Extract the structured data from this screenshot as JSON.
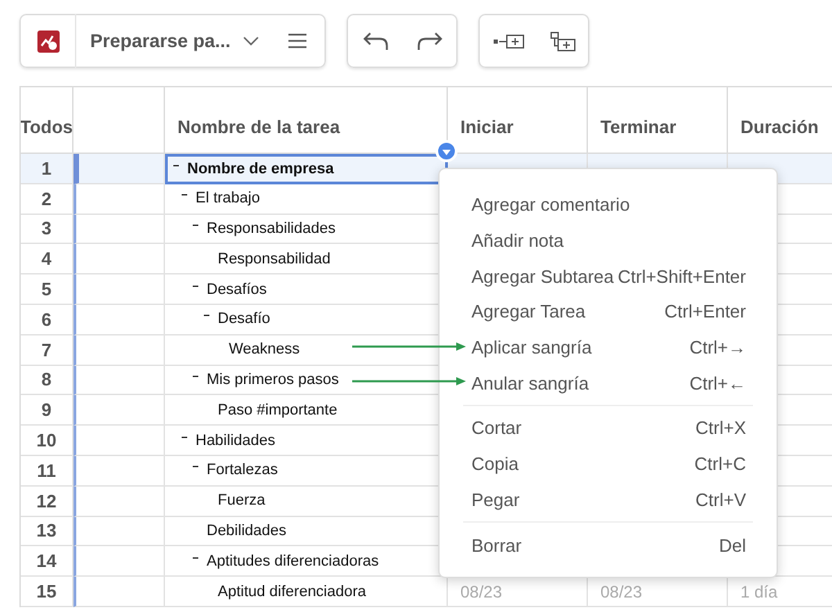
{
  "toolbar": {
    "title": "Prepararse pa..."
  },
  "table": {
    "columns": [
      "Todos",
      "Nombre de la tarea",
      "Iniciar",
      "Terminar",
      "Duración"
    ],
    "rows": [
      {
        "num": "1",
        "name": "Nombre de empresa",
        "selected": true,
        "expanded": true,
        "children": [
          {
            "num": "2",
            "name": "El trabajo",
            "selected": false,
            "expanded": true,
            "children": [
              {
                "num": "3",
                "name": "Responsabilidades",
                "selected": false,
                "expanded": true,
                "children": [
                  {
                    "num": "4",
                    "name": "Responsabilidad",
                    "selected": false
                  }
                ]
              },
              {
                "num": "5",
                "name": "Desafíos",
                "selected": false,
                "expanded": true,
                "children": [
                  {
                    "num": "6",
                    "name": "Desafío",
                    "selected": false,
                    "expanded": true,
                    "children": [
                      {
                        "num": "7",
                        "name": "Weakness",
                        "selected": false
                      }
                    ]
                  }
                ]
              },
              {
                "num": "8",
                "name": "Mis primeros pasos",
                "selected": false,
                "expanded": true,
                "children": [
                  {
                    "num": "9",
                    "name": "Paso #importante",
                    "selected": false
                  }
                ]
              }
            ]
          },
          {
            "num": "10",
            "name": "Habilidades",
            "selected": false,
            "expanded": true,
            "children": [
              {
                "num": "11",
                "name": "Fortalezas",
                "selected": false,
                "expanded": true,
                "children": [
                  {
                    "num": "12",
                    "name": "Fuerza",
                    "selected": false
                  }
                ]
              },
              {
                "num": "13",
                "name": "Debilidades",
                "selected": false
              },
              {
                "num": "14",
                "name": "Aptitudes diferenciadoras",
                "selected": false,
                "expanded": true,
                "children": [
                  {
                    "num": "15",
                    "name": "Aptitud diferenciadora",
                    "selected": false,
                    "start": "08/23",
                    "end": "08/23",
                    "duration": "1 día"
                  }
                ]
              }
            ]
          }
        ]
      }
    ]
  },
  "context_menu": {
    "items": [
      {
        "kind": "item",
        "label": "Agregar comentario",
        "arrow": false
      },
      {
        "kind": "item",
        "label": "Añadir nota",
        "arrow": false
      },
      {
        "kind": "item",
        "label": "Agregar Subtarea",
        "shortcut": "Ctrl+Shift+Enter",
        "arrow": false
      },
      {
        "kind": "item",
        "label": "Agregar Tarea",
        "shortcut": "Ctrl+Enter",
        "arrow": false
      },
      {
        "kind": "item",
        "label": "Aplicar sangría",
        "shortcut": "Ctrl+→",
        "arrow": true
      },
      {
        "kind": "item",
        "label": "Anular sangría",
        "shortcut": "Ctrl+←",
        "arrow": true
      },
      {
        "kind": "separator"
      },
      {
        "kind": "item",
        "label": "Cortar",
        "shortcut": "Ctrl+X",
        "arrow": false
      },
      {
        "kind": "item",
        "label": "Copia",
        "shortcut": "Ctrl+C",
        "arrow": false
      },
      {
        "kind": "item",
        "label": "Pegar",
        "shortcut": "Ctrl+V",
        "arrow": false
      },
      {
        "kind": "separator"
      },
      {
        "kind": "item",
        "label": "Borrar",
        "shortcut": "Del",
        "arrow": false
      }
    ]
  }
}
